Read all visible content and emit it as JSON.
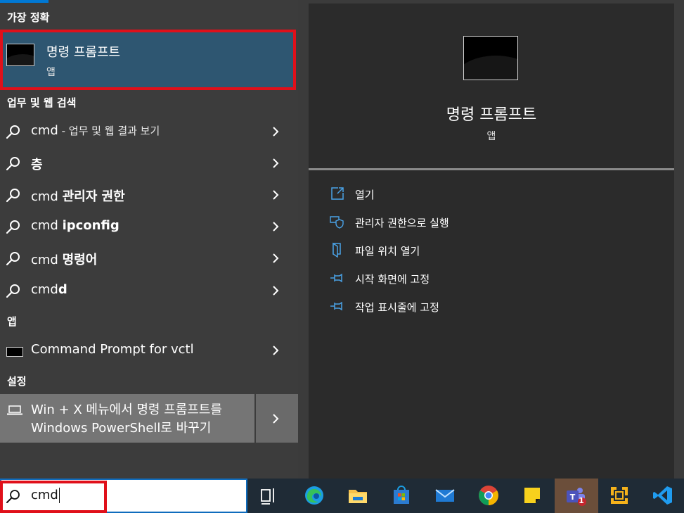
{
  "sections": {
    "best_match": "가장 정확",
    "web_search": "업무 및 웹 검색",
    "apps": "앱",
    "settings": "설정"
  },
  "best_match": {
    "title": "명령 프롬프트",
    "subtitle": "앱"
  },
  "search_results": [
    {
      "prefix": "cmd",
      "bold": "",
      "suffix": " - 업무 및 웹 결과 보기"
    },
    {
      "prefix": "",
      "bold": "층",
      "suffix": ""
    },
    {
      "prefix": "cmd ",
      "bold": "관리자 권한",
      "suffix": ""
    },
    {
      "prefix": "cmd ",
      "bold": "ipconfig",
      "suffix": ""
    },
    {
      "prefix": "cmd ",
      "bold": "명령어",
      "suffix": ""
    },
    {
      "prefix": "cmd",
      "bold": "d",
      "suffix": ""
    }
  ],
  "app_results": [
    {
      "label": "Command Prompt for vctl"
    }
  ],
  "settings_results": [
    {
      "line1": "Win + X 메뉴에서 명령 프롬프트를",
      "line2": "Windows PowerShell로 바꾸기"
    }
  ],
  "detail": {
    "title": "명령 프롬프트",
    "subtitle": "앱",
    "actions": [
      {
        "label": "열기",
        "icon": "open-icon"
      },
      {
        "label": "관리자 권한으로 실행",
        "icon": "shield-icon"
      },
      {
        "label": "파일 위치 열기",
        "icon": "file-location-icon"
      },
      {
        "label": "시작 화면에 고정",
        "icon": "pin-icon"
      },
      {
        "label": "작업 표시줄에 고정",
        "icon": "pin-icon"
      }
    ]
  },
  "search": {
    "query": "cmd"
  },
  "taskbar": {
    "apps": [
      "task-view-icon",
      "edge-icon",
      "file-explorer-icon",
      "store-icon",
      "mail-icon",
      "chrome-icon",
      "sticky-notes-icon",
      "teams-icon",
      "vmware-icon",
      "vscode-icon"
    ],
    "teams_badge": "1"
  },
  "colors": {
    "accent": "#0078d4",
    "highlight_border": "#e0101a",
    "selected_bg": "#2e5671"
  }
}
